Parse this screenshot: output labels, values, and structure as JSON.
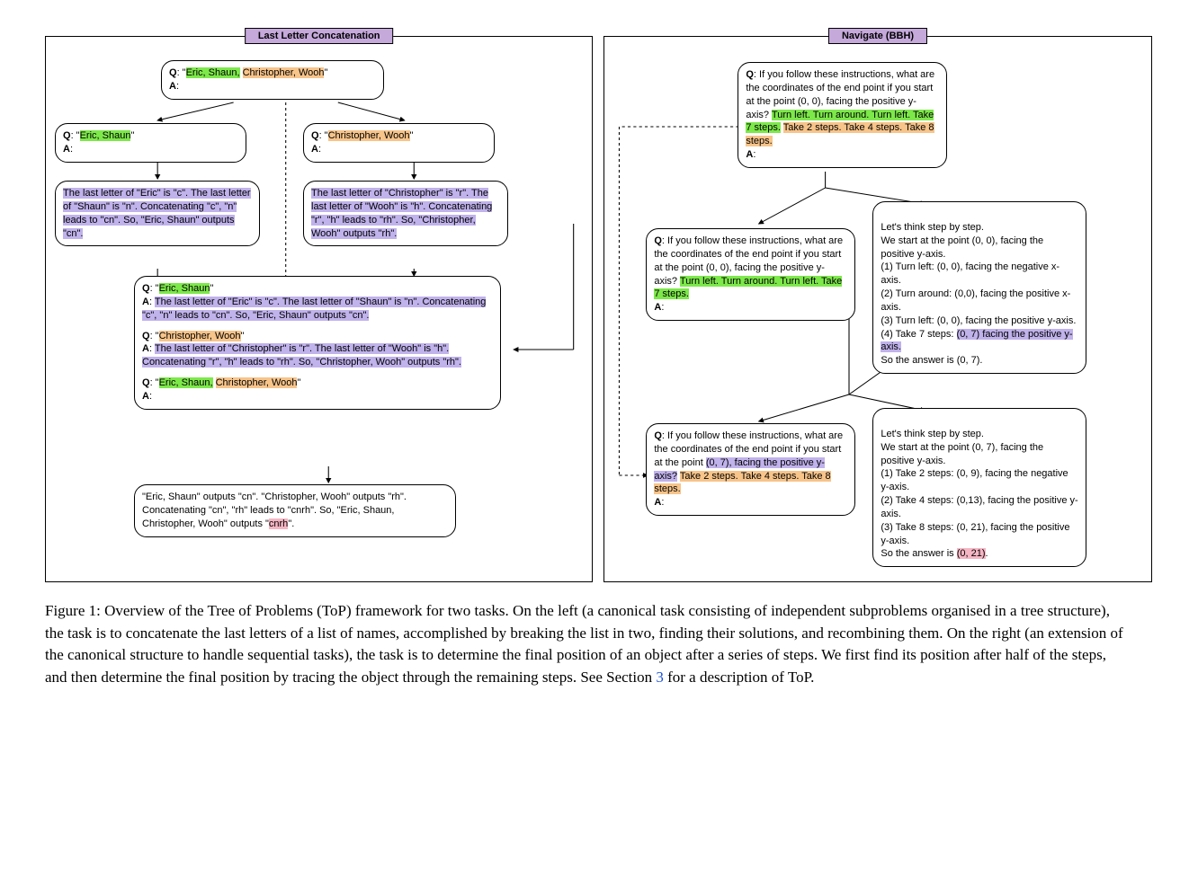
{
  "left": {
    "title": "Last Letter Concatenation",
    "box1_q": "Q",
    "box1_pre": ": \"",
    "box1_hl1": "Eric, Shaun,",
    "box1_mid": " ",
    "box1_hl2": "Christopher, Wooh",
    "box1_post": "\"",
    "box1_a": "A",
    "box1_ac": ":",
    "box2_q": "Q",
    "box2_pre": ": \"",
    "box2_hl": "Eric, Shaun",
    "box2_post": "\"",
    "box2_a": "A",
    "box2_ac": ":",
    "box3_q": "Q",
    "box3_pre": ": \"",
    "box3_hl": "Christopher, Wooh",
    "box3_post": "\"",
    "box3_a": "A",
    "box3_ac": ":",
    "box4": "The last letter of \"Eric\" is \"c\". The last letter of \"Shaun\" is \"n\". Concatenating \"c\", \"n\" leads to \"cn\". So, \"Eric, Shaun\" outputs \"cn\".",
    "box5": "The last letter of \"Christopher\" is \"r\". The last letter of \"Wooh\" is \"h\". Concatenating \"r\", \"h\" leads to \"rh\". So, \"Christopher, Wooh\" outputs \"rh\".",
    "box6_q1": "Q",
    "box6_q1pre": ": \"",
    "box6_q1hl": "Eric, Shaun",
    "box6_q1post": "\"",
    "box6_a1": "A",
    "box6_a1pre": ": ",
    "box6_a1hl": "The last letter of \"Eric\" is \"c\". The last letter of \"Shaun\" is \"n\". Concatenating \"c\", \"n\" leads to \"cn\". So, \"Eric, Shaun\" outputs \"cn\".",
    "box6_q2": "Q",
    "box6_q2pre": ": \"",
    "box6_q2hl": "Christopher, Wooh",
    "box6_q2post": "\"",
    "box6_a2": "A",
    "box6_a2pre": ": ",
    "box6_a2hl": "The last letter of \"Christopher\" is \"r\". The last letter of \"Wooh\" is \"h\". Concatenating \"r\", \"h\" leads to \"rh\". So, \"Christopher, Wooh\" outputs \"rh\".",
    "box6_q3": "Q",
    "box6_q3pre": ": \"",
    "box6_q3hl1": "Eric, Shaun,",
    "box6_q3mid": " ",
    "box6_q3hl2": "Christopher, Wooh",
    "box6_q3post": "\"",
    "box6_a3": "A",
    "box6_a3c": ":",
    "box7_pre": "\"Eric, Shaun\" outputs \"cn\". \"Christopher, Wooh\" outputs \"rh\". Concatenating \"cn\", \"rh\" leads to \"cnrh\". So,  \"Eric, Shaun, Christopher, Wooh\" outputs \"",
    "box7_hl": "cnrh",
    "box7_post": "\"."
  },
  "right": {
    "title": "Navigate (BBH)",
    "box1_q": "Q",
    "box1_t1": ": If you follow these instructions, what are the coordinates of the end point if you start at the point (0, 0), facing the positive y-axis? ",
    "box1_hl1": "Turn left. Turn around. Turn left. Take 7 steps.",
    "box1_mid": " ",
    "box1_hl2": "Take 2 steps. Take 4 steps. Take 8 steps.",
    "box1_a": "A",
    "box1_ac": ":",
    "box2_q": "Q",
    "box2_t": ": If you follow these instructions, what are the coordinates of the end point if you start at the point (0, 0), facing the positive y-axis? ",
    "box2_hl": "Turn left. Turn around. Turn left. Take 7 steps.",
    "box2_a": "A",
    "box2_ac": ":",
    "box3_pre": "Let's think step by step.\nWe start at the point (0, 0), facing the positive y-axis.\n(1) Turn left: (0, 0), facing the negative x-axis.\n(2) Turn around: (0,0), facing the positive x-axis.\n(3) Turn left: (0, 0), facing the positive y-axis.\n(4) Take 7 steps: ",
    "box3_hl": "(0, 7) facing the positive y-axis.",
    "box3_post": "\nSo the answer is (0, 7).",
    "box4_q": "Q",
    "box4_t1": ": If you follow these instructions, what are the coordinates of the end point if you start at the point ",
    "box4_hl1": "(0, 7), facing the positive y-axis?",
    "box4_mid": " ",
    "box4_hl2": "Take 2 steps. Take 4 steps. Take 8 steps.",
    "box4_a": "A",
    "box4_ac": ":",
    "box5_pre": "Let's think step by step.\nWe start at the point (0, 7), facing the positive y-axis.\n(1) Take 2 steps: (0, 9), facing the negative y-axis.\n(2) Take 4 steps: (0,13), facing the positive y-axis.\n(3) Take 8 steps: (0, 21), facing the positive y-axis.\nSo the answer is ",
    "box5_hl": "(0, 21)",
    "box5_post": "."
  },
  "caption": {
    "pre": "Figure 1: Overview of the Tree of Problems (ToP) framework for two tasks. On the left (a canonical task consisting of independent subproblems organised in a tree structure), the task is to concatenate the last letters of a list of names, accomplished by breaking the list in two, finding their solutions, and recombining them. On the right (an extension of the canonical structure to handle sequential tasks), the task is to determine the final position of an object after a series of steps. We first find its position after half of the steps, and then determine the final position by tracing the object through the remaining steps. See Section ",
    "link": "3",
    "post": " for a description of ToP."
  }
}
